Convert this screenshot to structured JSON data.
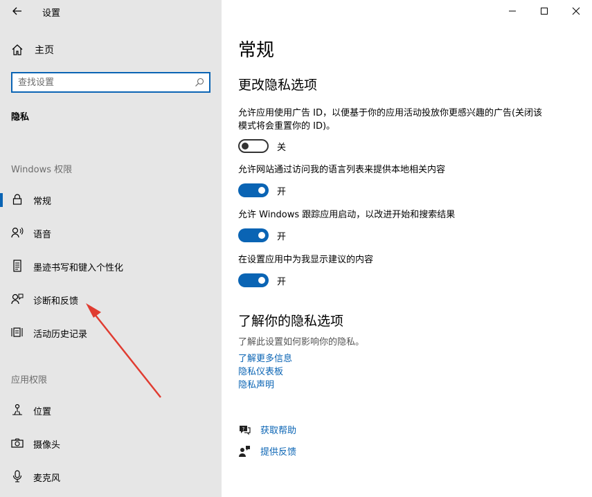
{
  "window": {
    "title": "设置"
  },
  "sidebar": {
    "home_label": "主页",
    "search_placeholder": "查找设置",
    "section_title": "隐私",
    "groups": [
      {
        "header": "Windows 权限",
        "items": [
          {
            "label": "常规",
            "icon": "lock-icon",
            "active": true
          },
          {
            "label": "语音",
            "icon": "speech-icon",
            "active": false
          },
          {
            "label": "墨迹书写和键入个性化",
            "icon": "inking-icon",
            "active": false
          },
          {
            "label": "诊断和反馈",
            "icon": "feedback-person-icon",
            "active": false
          },
          {
            "label": "活动历史记录",
            "icon": "activity-history-icon",
            "active": false
          }
        ]
      },
      {
        "header": "应用权限",
        "items": [
          {
            "label": "位置",
            "icon": "location-icon",
            "active": false
          },
          {
            "label": "摄像头",
            "icon": "camera-icon",
            "active": false
          },
          {
            "label": "麦克风",
            "icon": "microphone-icon",
            "active": false
          }
        ]
      }
    ]
  },
  "content": {
    "page_title": "常规",
    "section_title": "更改隐私选项",
    "settings": [
      {
        "description": "允许应用使用广告 ID，以便基于你的应用活动投放你更感兴趣的广告(关闭该模式将会重置你的 ID)。",
        "state": "关",
        "on": false
      },
      {
        "description": "允许网站通过访问我的语言列表来提供本地相关内容",
        "state": "开",
        "on": true
      },
      {
        "description": "允许 Windows 跟踪应用启动，以改进开始和搜索结果",
        "state": "开",
        "on": true
      },
      {
        "description": "在设置应用中为我显示建议的内容",
        "state": "开",
        "on": true
      }
    ],
    "learn_title": "了解你的隐私选项",
    "learn_desc": "了解此设置如何影响你的隐私。",
    "links": [
      "了解更多信息",
      "隐私仪表板",
      "隐私声明"
    ],
    "help": {
      "get_help": "获取帮助",
      "give_feedback": "提供反馈"
    }
  },
  "colors": {
    "accent": "#0a64b4",
    "sidebar_bg": "#e6e6e6",
    "annotation_arrow": "#e03c31"
  }
}
